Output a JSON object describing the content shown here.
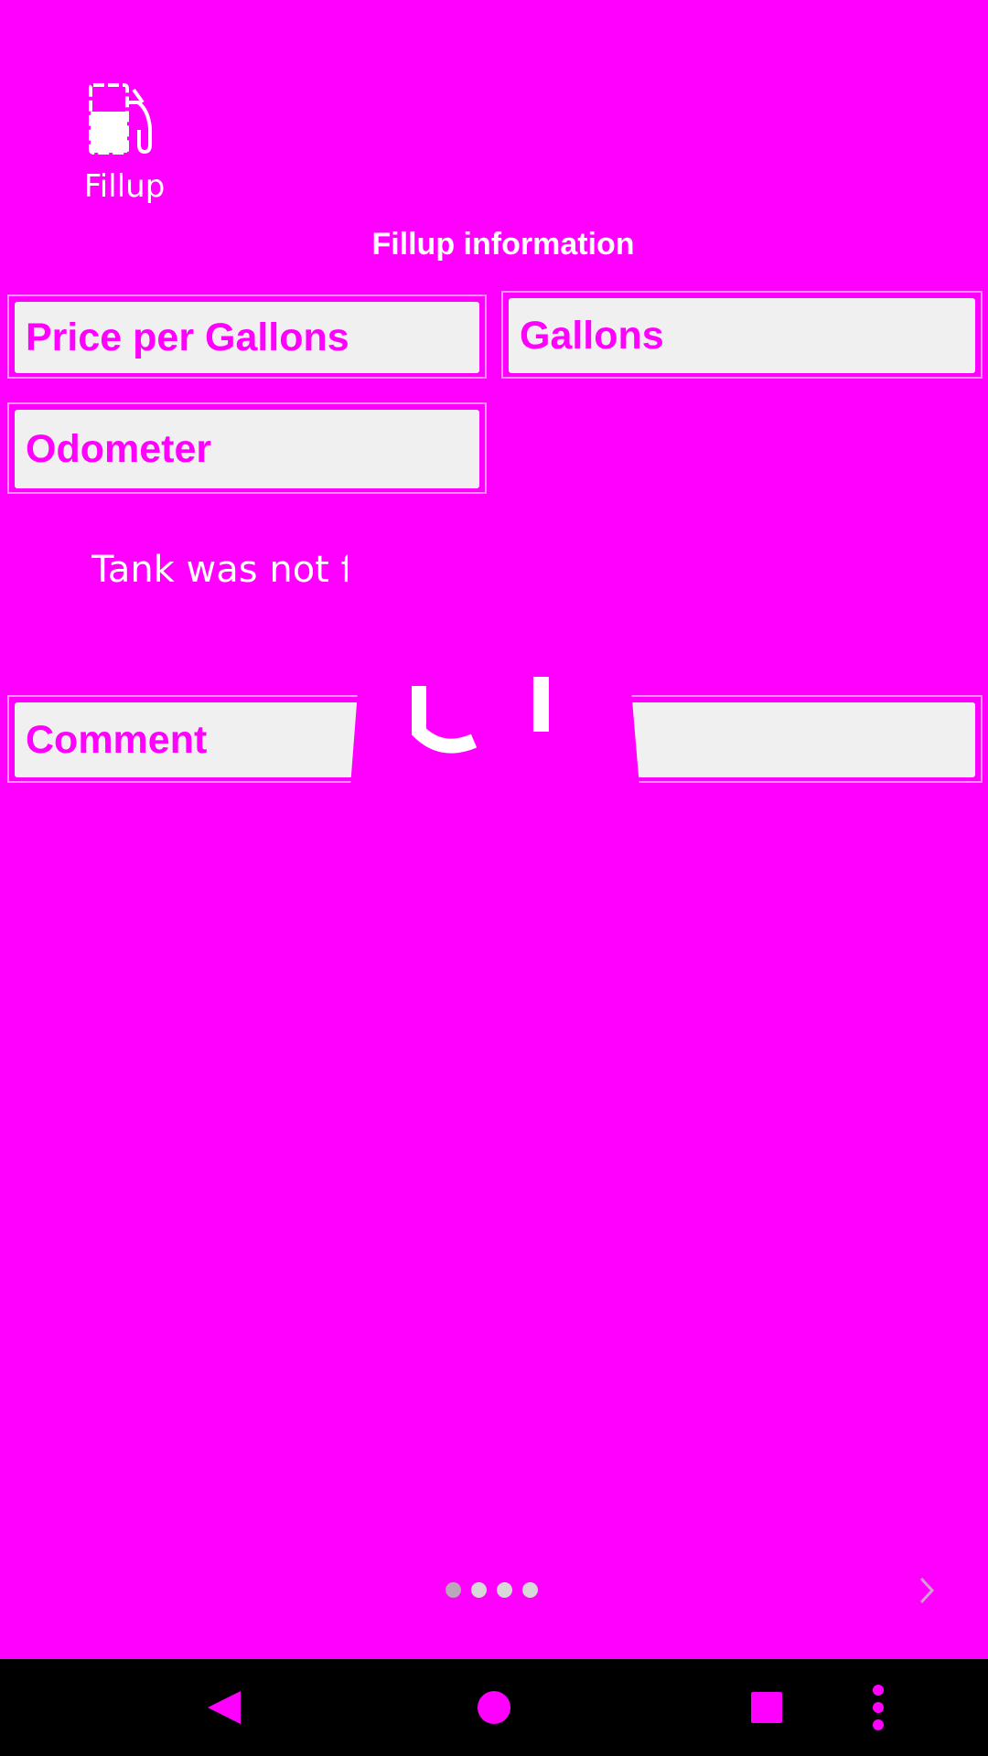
{
  "header": {
    "title": "Fillup",
    "icon": "gas-pump-icon"
  },
  "section_title": "Fillup information",
  "fields": {
    "price_per_gallon": {
      "placeholder": "Price per Gallons",
      "value": ""
    },
    "gallons": {
      "placeholder": "Gallons",
      "value": ""
    },
    "odometer": {
      "placeholder": "Odometer",
      "value": ""
    },
    "comment": {
      "placeholder": "Comment",
      "value": ""
    }
  },
  "tank_checkbox": {
    "label": "Tank was not fi",
    "checked": false
  },
  "pagination": {
    "page_count": 4,
    "current_page": 1,
    "next_icon": "chevron-right-icon"
  },
  "nav_bar": {
    "back_icon": "back-triangle-icon",
    "home_icon": "home-circle-icon",
    "recents_icon": "recents-square-icon",
    "menu_icon": "overflow-menu-icon"
  },
  "colors": {
    "background": "#ff00ff",
    "field_background": "#f0f0f0",
    "text_on_background": "#ffffff",
    "nav_bar": "#000000"
  }
}
